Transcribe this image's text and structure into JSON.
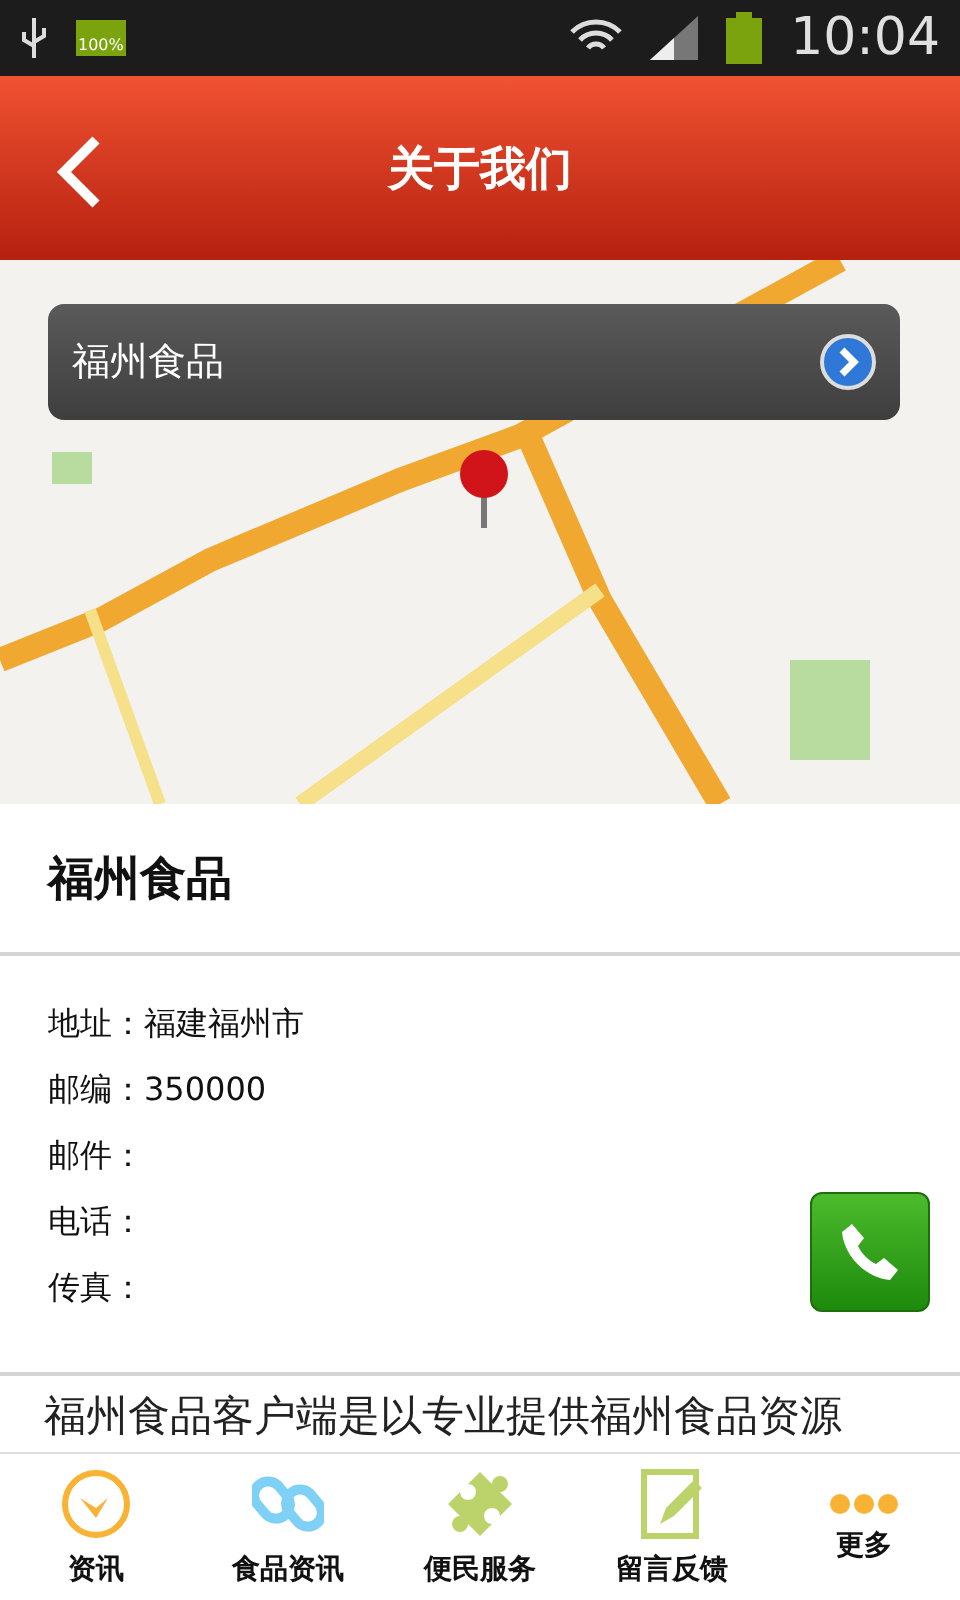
{
  "status_bar": {
    "time": "10:04",
    "battery_text": "100%"
  },
  "header": {
    "title": "关于我们"
  },
  "map": {
    "popup_title": "福州食品"
  },
  "company": {
    "name": "福州食品",
    "details": [
      {
        "label": "地址：",
        "value": "福建福州市"
      },
      {
        "label": "邮编：",
        "value": "350000"
      },
      {
        "label": "邮件："
      },
      {
        "label": "电话："
      },
      {
        "label": "传真："
      }
    ],
    "description": "福州食品客户端是以专业提供福州食品资源"
  },
  "tab_bar": [
    {
      "label": "资讯",
      "kind": "clock"
    },
    {
      "label": "食品资讯",
      "kind": "link"
    },
    {
      "label": "便民服务",
      "kind": "puzzle"
    },
    {
      "label": "留言反馈",
      "kind": "note"
    },
    {
      "label": "更多",
      "kind": "more"
    }
  ]
}
